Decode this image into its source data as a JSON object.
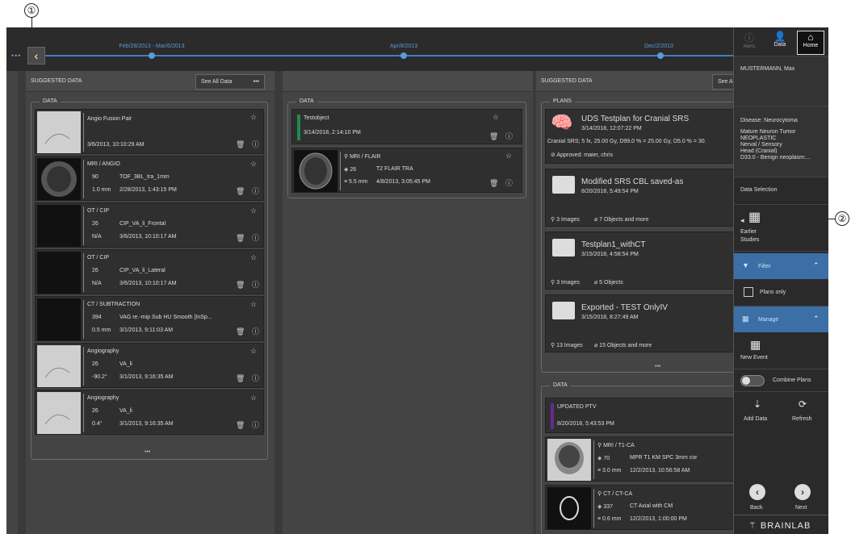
{
  "callouts": [
    "①",
    "②"
  ],
  "timeline": {
    "back_icon": "‹",
    "more_dots": "•••",
    "dates": [
      "Feb/28/2013 - Mar/6/2013",
      "Apr/8/2013",
      "Dec/2/2013"
    ]
  },
  "col1": {
    "header": "SUGGESTED DATA",
    "see_all": "See All Data",
    "more": "•••",
    "group": "DATA",
    "cards": [
      {
        "lines": [
          "Angio Fusion Pair",
          "",
          "3/6/2013, 10:10:29 AM"
        ],
        "thumb": "light"
      },
      {
        "lines": [
          "MRI / ANGIO",
          "90",
          "TOF_3BL_tra_1mm",
          "1.0 mm",
          "2/28/2013, 1:43:15 PM"
        ],
        "thumb": "mri"
      },
      {
        "lines": [
          "OT / CIP",
          "26",
          "CIP_VA_li_Frontal",
          "N/A",
          "3/6/2013, 10:10:17 AM"
        ],
        "thumb": "dark"
      },
      {
        "lines": [
          "OT / CIP",
          "26",
          "CIP_VA_li_Lateral",
          "N/A",
          "3/6/2013, 10:10:17 AM"
        ],
        "thumb": "dark"
      },
      {
        "lines": [
          "CT / SUBTRACTION",
          "394",
          "VAG re.-mip Sub HU Smooth [InSp...",
          "0.5 mm",
          "3/1/2013, 9:11:03 AM"
        ],
        "thumb": "dark"
      },
      {
        "lines": [
          "Angiography",
          "26",
          "VA_li",
          "-90.2°",
          "3/1/2013, 9:16:35 AM"
        ],
        "thumb": "light"
      },
      {
        "lines": [
          "Angiography",
          "26",
          "VA_li",
          "0.4°",
          "3/1/2013, 9:16:35 AM"
        ],
        "thumb": "light"
      }
    ],
    "footer_dots": "•••"
  },
  "col2": {
    "group": "DATA",
    "card1": {
      "title": "Testobject",
      "date": "3/14/2018, 2:14:10 PM",
      "bar_color": "#1e8a4c"
    },
    "card2": {
      "modality": "MRI / FLAIR",
      "count": "26",
      "series": "T2 FLAIR TRA",
      "thickness": "5.5 mm",
      "date": "4/8/2013, 3:05:45 PM"
    }
  },
  "col3": {
    "header": "SUGGESTED DATA",
    "see_all": "See A",
    "plans_group": "PLANS",
    "plan1": {
      "title": "UDS Testplan for Cranial SRS",
      "date": "3/14/2018, 12:07:22 PM",
      "desc": "Cranial SRS; 5 fx, 25.00 Gy, D99.0 % = 25.00 Gy, D5.0 % = 30.",
      "approved": "Approved:  maier, chris"
    },
    "folders": [
      {
        "title": "Modified SRS CBL saved-as",
        "date": "8/20/2018, 5:49:54 PM",
        "images": "3 Images",
        "objects": "7 Objects and more"
      },
      {
        "title": "Testplan1_withCT",
        "date": "3/15/2018, 4:58:54 PM",
        "images": "3 Images",
        "objects": "5 Objects"
      },
      {
        "title": "Exported - TEST OnlyIV",
        "date": "3/15/2018, 8:27:49 AM",
        "images": "13 Images",
        "objects": "15 Objects and more"
      }
    ],
    "more": "•••",
    "data_group": "DATA",
    "ptv": {
      "title": "UPDATED PTV",
      "date": "8/20/2018, 5:43:53 PM",
      "bar_color": "#6a2a8a"
    },
    "mri": {
      "modality": "MRI / T1-CA",
      "count": "70",
      "series": "MPR T1 KM SPC 3mm cor",
      "thickness": "3.0 mm",
      "date": "12/2/2013, 10:56:58 AM"
    },
    "ct": {
      "modality": "CT / CT-CA",
      "count": "337",
      "series": "CT Axial with CM",
      "thickness": "0.6 mm",
      "date": "12/2/2013, 1:00:00 PM"
    }
  },
  "sidebar": {
    "alerts": "Alerts",
    "data": "Data",
    "home": "Home",
    "patient": "MUSTERMANN, Max",
    "disease_label": "Disease:  Neurocytoma",
    "disease_lines": [
      "Mature Neuron Tumor",
      "NEOPLASTIC",
      "Nerval / Sensory",
      "Head (Cranial)",
      "D33.0 - Benign neoplasm:..."
    ],
    "data_selection": "Data Selection",
    "earlier": "Earlier",
    "studies": "Studies",
    "filter": "Filter",
    "plans_only": "Plans only",
    "manage": "Manage",
    "new_event": "New Event",
    "combine": "Combine Plans",
    "add_data": "Add Data",
    "refresh": "Refresh",
    "back": "Back",
    "next": "Next",
    "brand": "BRAINLAB"
  },
  "colors": {
    "accent": "#3b7fc4",
    "sidebar_blue": "#3b6fa5"
  }
}
